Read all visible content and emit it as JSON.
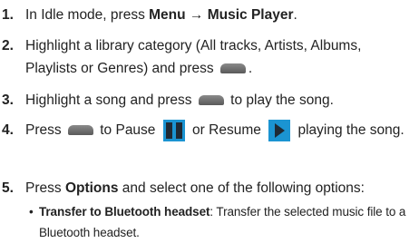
{
  "steps": [
    {
      "number": "1.",
      "parts": {
        "a": "In Idle mode, press ",
        "b": "Menu → Music Player",
        "c": "."
      }
    },
    {
      "number": "2.",
      "parts": {
        "a": "Highlight a library category (All tracks, Artists, Albums, Playlists or Genres) and press ",
        "c": "."
      },
      "icon": "select-key-icon"
    },
    {
      "number": "3.",
      "parts": {
        "a": "Highlight a song and press ",
        "c": " to play the song."
      },
      "icon": "select-key-icon"
    },
    {
      "number": "4.",
      "parts": {
        "a": "Press ",
        "b": " to Pause ",
        "c": " or Resume ",
        "d": " playing the song."
      },
      "icons": [
        "select-key-icon",
        "pause-icon",
        "play-icon"
      ]
    },
    {
      "number": "5.",
      "parts": {
        "a": "Press ",
        "b": "Options",
        "c": " and select one of the following options:"
      }
    }
  ],
  "sub_options": [
    {
      "bullet": "•",
      "label": "Transfer to Bluetooth headset",
      "text": ": Transfer the selected music file to a Bluetooth headset."
    }
  ],
  "colors": {
    "icon_blue": "#1b94d2",
    "key_gray": "#6e6e6e",
    "text": "#222222"
  }
}
